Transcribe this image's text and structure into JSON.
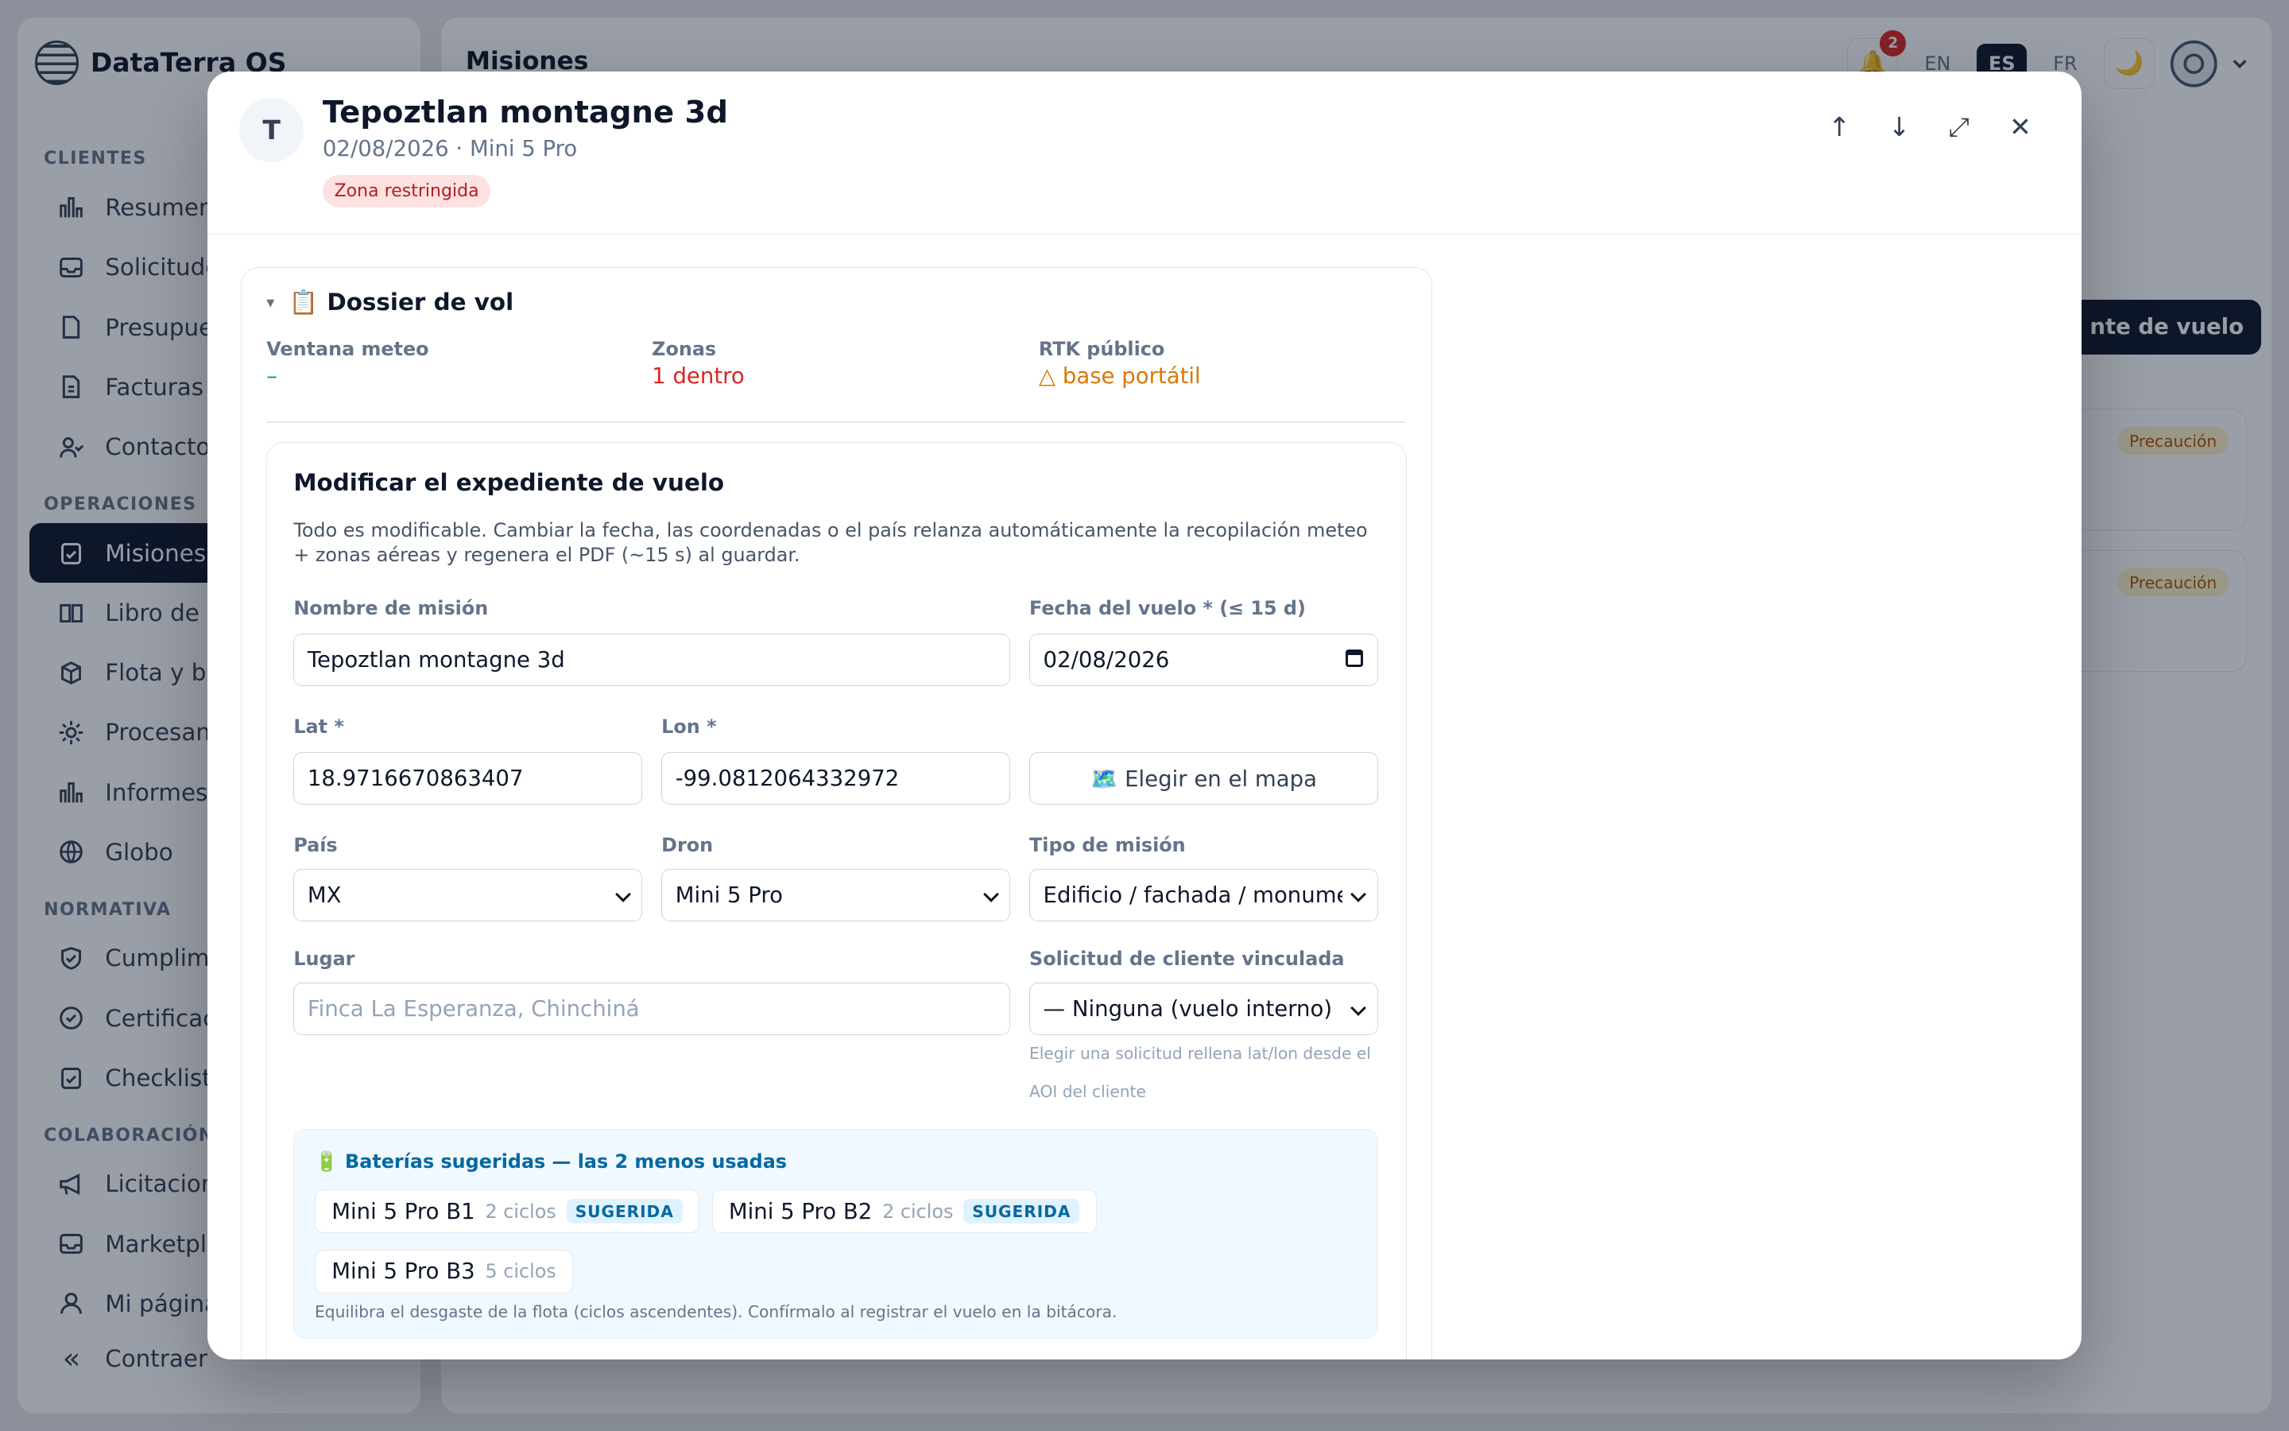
{
  "app": {
    "name": "DataTerra OS"
  },
  "sidebar": {
    "sections": [
      {
        "label": "CLIENTES",
        "items": [
          {
            "label": "Resumen",
            "icon": "chart-icon"
          },
          {
            "label": "Solicitude",
            "icon": "inbox-icon"
          },
          {
            "label": "Presupues",
            "icon": "file-icon"
          },
          {
            "label": "Facturas",
            "icon": "invoice-icon"
          },
          {
            "label": "Contactos",
            "icon": "contacts-icon"
          }
        ]
      },
      {
        "label": "OPERACIONES",
        "items": [
          {
            "label": "Misiones",
            "icon": "clipboard-icon",
            "active": true
          },
          {
            "label": "Libro de v",
            "icon": "book-icon"
          },
          {
            "label": "Flota y ba",
            "icon": "cube-icon"
          },
          {
            "label": "Procesam",
            "icon": "gear-icon"
          },
          {
            "label": "Informes y",
            "icon": "report-icon"
          },
          {
            "label": "Globo",
            "icon": "globe-icon"
          }
        ]
      },
      {
        "label": "NORMATIVA",
        "items": [
          {
            "label": "Cumplimie",
            "icon": "shield-icon"
          },
          {
            "label": "Certificaci",
            "icon": "check-circle-icon"
          },
          {
            "label": "Checklist d",
            "icon": "checklist-icon"
          }
        ]
      },
      {
        "label": "COLABORACIÓN",
        "items": [
          {
            "label": "Licitacione",
            "icon": "megaphone-icon"
          },
          {
            "label": "Marketpla",
            "icon": "store-icon"
          },
          {
            "label": "Mi página",
            "icon": "user-icon"
          }
        ]
      }
    ],
    "collapse_label": "Contraer"
  },
  "main": {
    "title": "Misiones",
    "notifications_count": "2",
    "languages": [
      "EN",
      "ES",
      "FR"
    ],
    "active_language": "ES",
    "cta_label": "nte de vuelo",
    "card_badges": [
      "Precaución",
      "Precaución"
    ]
  },
  "modal": {
    "avatar_initial": "T",
    "title": "Tepoztlan montagne 3d",
    "subtitle": "02/08/2026 · Mini 5 Pro",
    "badge": "Zona restringida",
    "actions": {
      "up": "↑",
      "down": "↓",
      "expand": "⤢",
      "close": "✕"
    },
    "dossier": {
      "caret": "▾",
      "emoji": "📋",
      "title": "Dossier de vol",
      "stats": [
        {
          "label": "Ventana meteo",
          "value": "–",
          "color": "#16a34a"
        },
        {
          "label": "Zonas",
          "value": "1 dentro",
          "color": "#dc2626"
        },
        {
          "label": "RTK público",
          "value": "△ base portátil",
          "color": "#d97706"
        }
      ]
    },
    "form": {
      "title": "Modificar el expediente de vuelo",
      "description": "Todo es modificable. Cambiar la fecha, las coordenadas o el país relanza automáticamente la recopilación meteo + zonas aéreas y regenera el PDF (~15 s) al guardar.",
      "mission_name": {
        "label": "Nombre de misión",
        "value": "Tepoztlan montagne 3d"
      },
      "flight_date": {
        "label": "Fecha del vuelo * (≤ 15 d)",
        "value": "02/08/2026"
      },
      "lat": {
        "label": "Lat *",
        "value": "18.9716670863407"
      },
      "lon": {
        "label": "Lon *",
        "value": "-99.0812064332972"
      },
      "map_button": "🗺️ Elegir en el mapa",
      "country": {
        "label": "País",
        "value": "MX"
      },
      "drone": {
        "label": "Dron",
        "value": "Mini 5 Pro"
      },
      "mission_type": {
        "label": "Tipo de misión",
        "value": "Edificio / fachada / monumento"
      },
      "place": {
        "label": "Lugar",
        "placeholder": "Finca La Esperanza, Chinchiná"
      },
      "client_request": {
        "label": "Solicitud de cliente vinculada",
        "value": "— Ninguna (vuelo interno)",
        "hint": "Elegir una solicitud rellena lat/lon desde el AOI del cliente"
      },
      "batteries": {
        "emoji": "🔋",
        "title": "Baterías sugeridas — las 2 menos usadas",
        "items": [
          {
            "name": "Mini 5 Pro B1",
            "cycles": "2 ciclos",
            "tag": "SUGERIDA"
          },
          {
            "name": "Mini 5 Pro B2",
            "cycles": "2 ciclos",
            "tag": "SUGERIDA"
          },
          {
            "name": "Mini 5 Pro B3",
            "cycles": "5 ciclos",
            "tag": ""
          }
        ],
        "footer": "Equilibra el desgaste de la flota (ciclos ascendentes). Confírmalo al registrar el vuelo en la bitácora."
      }
    }
  }
}
